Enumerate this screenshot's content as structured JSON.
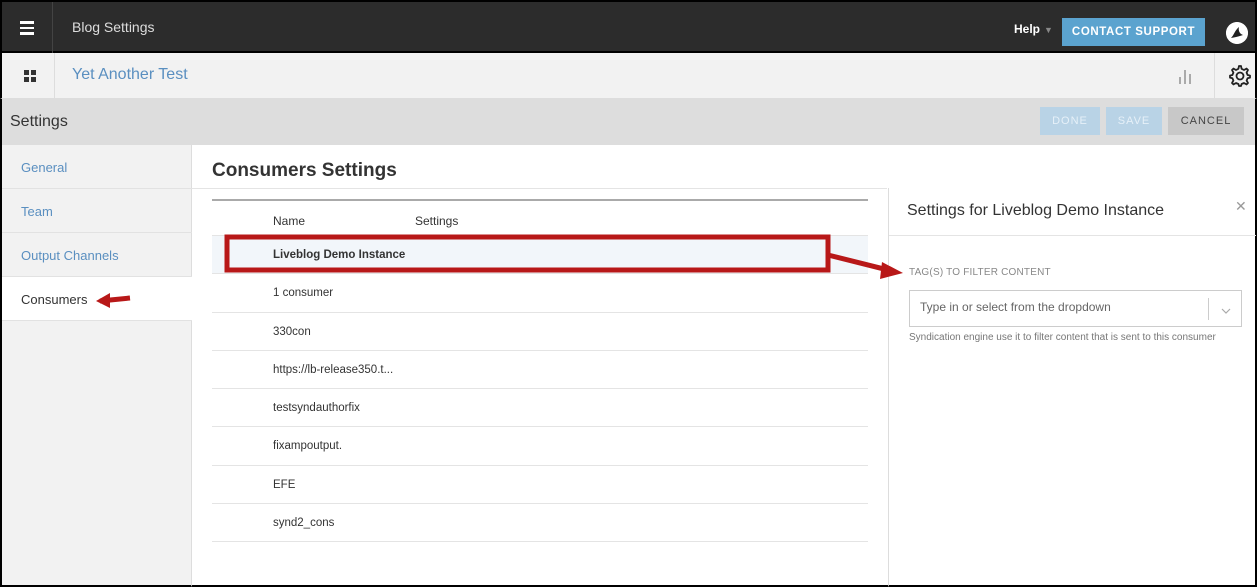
{
  "topbar": {
    "title": "Blog Settings",
    "help_label": "Help",
    "contact_support_label": "CONTACT SUPPORT"
  },
  "blogbar": {
    "blog_name": "Yet Another Test"
  },
  "settings_bar": {
    "title": "Settings",
    "done_label": "DONE",
    "save_label": "SAVE",
    "cancel_label": "CANCEL"
  },
  "sidebar": {
    "items": [
      {
        "label": "General"
      },
      {
        "label": "Team"
      },
      {
        "label": "Output Channels"
      },
      {
        "label": "Consumers"
      }
    ],
    "active": "Consumers"
  },
  "main": {
    "title": "Consumers Settings",
    "columns": {
      "name": "Name",
      "settings": "Settings"
    },
    "rows": [
      "Liveblog Demo Instance",
      "1 consumer",
      "330con",
      "https://lb-release350.t...",
      "testsyndauthorfix",
      "fixampoutput.",
      "EFE",
      "synd2_cons"
    ],
    "selected_row": "Liveblog Demo Instance"
  },
  "panel": {
    "title": "Settings for Liveblog Demo Instance",
    "tags_label": "TAG(S) TO FILTER CONTENT",
    "tags_placeholder": "Type in or select from the dropdown",
    "tags_help": "Syndication engine use it to filter content that is sent to this consumer"
  },
  "icons": {
    "menu": "hamburger-icon",
    "grid": "grid-icon",
    "stats": "bar-chart-icon",
    "settings": "gear-icon",
    "close": "close-icon",
    "dropdown": "chevron-down-icon"
  },
  "colors": {
    "topbar_bg": "#2c2c2c",
    "accent": "#5ba3cf",
    "link": "#5a8fc0",
    "annotation": "#d11f1f"
  }
}
